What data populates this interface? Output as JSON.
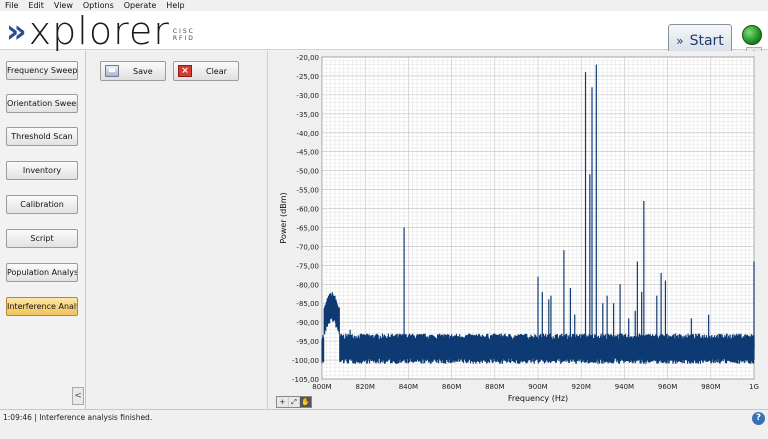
{
  "menubar": {
    "items": [
      "File",
      "Edit",
      "View",
      "Options",
      "Operate",
      "Help"
    ]
  },
  "header": {
    "logo": {
      "text": "xplorer",
      "sub_top": "CISC",
      "sub_bottom": "RFID"
    },
    "start_label": "Start",
    "status_led_color": "#1e8f1e"
  },
  "sidebar": {
    "items": [
      {
        "label": "Frequency Sweep",
        "active": false
      },
      {
        "label": "Orientation Sweep",
        "active": false
      },
      {
        "label": "Threshold Scan",
        "active": false
      },
      {
        "label": "Inventory",
        "active": false
      },
      {
        "label": "Calibration",
        "active": false
      },
      {
        "label": "Script",
        "active": false
      },
      {
        "label": "Population Analysis",
        "active": false
      },
      {
        "label": "Interference Analysis",
        "active": true
      }
    ],
    "collapse_icon": "<"
  },
  "actions": {
    "save_label": "Save",
    "clear_label": "Clear"
  },
  "chart_data": {
    "type": "line",
    "xlabel": "Frequency (Hz)",
    "ylabel": "Power (dBm)",
    "x_ticks": [
      "800M",
      "820M",
      "840M",
      "860M",
      "880M",
      "900M",
      "920M",
      "940M",
      "960M",
      "980M",
      "1G"
    ],
    "y_ticks": [
      "-20,00",
      "-25,00",
      "-30,00",
      "-35,00",
      "-40,00",
      "-45,00",
      "-50,00",
      "-55,00",
      "-60,00",
      "-65,00",
      "-70,00",
      "-75,00",
      "-80,00",
      "-85,00",
      "-90,00",
      "-95,00",
      "-100,00",
      "-105,00"
    ],
    "xlim_mhz": [
      800,
      1000
    ],
    "ylim": [
      -105,
      -20
    ],
    "grid": true,
    "line_color": "#0e3a73",
    "noise_floor": -97,
    "peaks": [
      {
        "x": 813,
        "y": -92
      },
      {
        "x": 838,
        "y": -65
      },
      {
        "x": 820,
        "y": -94
      },
      {
        "x": 883,
        "y": -93
      },
      {
        "x": 900,
        "y": -78
      },
      {
        "x": 902,
        "y": -82
      },
      {
        "x": 905,
        "y": -84
      },
      {
        "x": 906,
        "y": -83
      },
      {
        "x": 912,
        "y": -71
      },
      {
        "x": 915,
        "y": -81
      },
      {
        "x": 917,
        "y": -88
      },
      {
        "x": 922,
        "y": -24
      },
      {
        "x": 924,
        "y": -51
      },
      {
        "x": 925,
        "y": -28
      },
      {
        "x": 927,
        "y": -22
      },
      {
        "x": 930,
        "y": -85
      },
      {
        "x": 932,
        "y": -83
      },
      {
        "x": 935,
        "y": -85
      },
      {
        "x": 938,
        "y": -80
      },
      {
        "x": 942,
        "y": -89
      },
      {
        "x": 945,
        "y": -87
      },
      {
        "x": 946,
        "y": -74
      },
      {
        "x": 948,
        "y": -82
      },
      {
        "x": 949,
        "y": -58
      },
      {
        "x": 955,
        "y": -83
      },
      {
        "x": 957,
        "y": -77
      },
      {
        "x": 959,
        "y": -79
      },
      {
        "x": 971,
        "y": -89
      },
      {
        "x": 979,
        "y": -88
      },
      {
        "x": 1000,
        "y": -74
      }
    ]
  },
  "zoom_tools": [
    "+",
    "⤢",
    "✋"
  ],
  "status": {
    "text": "1:09:46 | Interference analysis finished."
  },
  "help_icon": "?"
}
